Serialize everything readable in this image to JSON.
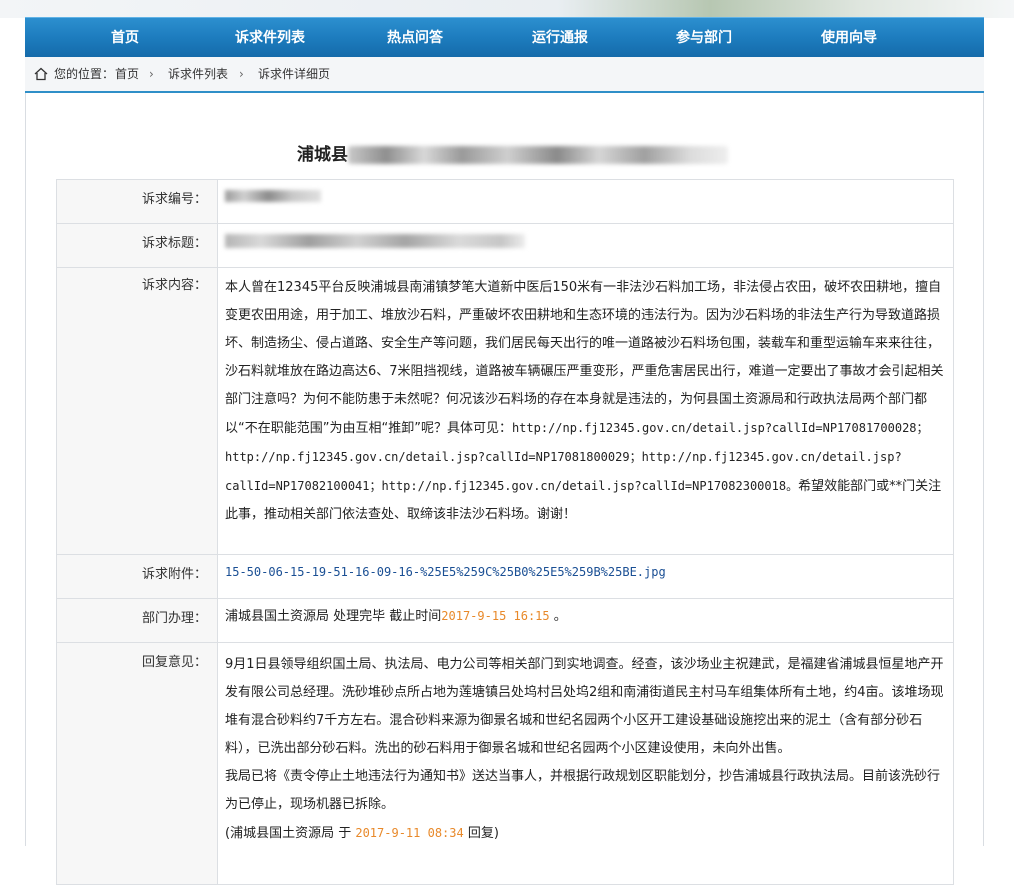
{
  "nav": {
    "items": [
      "首页",
      "诉求件列表",
      "热点问答",
      "运行通报",
      "参与部门",
      "使用向导"
    ]
  },
  "breadcrumb": {
    "prefix": "您的位置：",
    "items": [
      "首页",
      "诉求件列表",
      "诉求件详细页"
    ]
  },
  "page": {
    "title_prefix": "浦城县"
  },
  "detail": {
    "labels": {
      "number": "诉求编号：",
      "subject": "诉求标题：",
      "content": "诉求内容：",
      "attachment": "诉求附件：",
      "department": "部门办理：",
      "reply": "回复意见："
    },
    "content": {
      "part1": "本人曾在12345平台反映浦城县南浦镇梦笔大道新中医后150米有一非法沙石料加工场，非法侵占农田，破坏农田耕地，擅自变更农田用途，用于加工、堆放沙石料，严重破坏农田耕地和生态环境的违法行为。因为沙石料场的非法生产行为导致道路损坏、制造扬尘、侵占道路、安全生产等问题，我们居民每天出行的唯一道路被沙石料场包围，装载车和重型运输车来来往往，沙石料就堆放在路边高达6、7米阻挡视线，道路被车辆碾压严重变形，严重危害居民出行，难道一定要出了事故才会引起相关部门注意吗？为何不能防患于未然呢？何况该沙石料场的存在本身就是违法的，为何县国土资源局和行政执法局两个部门都以“不在职能范围”为由互相“推卸”呢？具体可见：",
      "links": "http://np.fj12345.gov.cn/detail.jsp?callId=NP17081700028；http://np.fj12345.gov.cn/detail.jsp?callId=NP17081800029；http://np.fj12345.gov.cn/detail.jsp?callId=NP17082100041；http://np.fj12345.gov.cn/detail.jsp?callId=NP17082300018。",
      "part2": "希望效能部门或**门关注此事，推动相关部门依法查处、取缔该非法沙石料场。谢谢！"
    },
    "attachment": "15-50-06-15-19-51-16-09-16-%25E5%259C%25B0%25E5%259B%25BE.jpg",
    "department": {
      "text": "浦城县国土资源局 处理完毕 截止时间",
      "deadline": "2017-9-15 16:15",
      "suffix": "。"
    },
    "reply": {
      "p1": "9月1日县领导组织国土局、执法局、电力公司等相关部门到实地调查。经查，该沙场业主祝建武，是福建省浦城县恒星地产开发有限公司总经理。洗砂堆砂点所占地为莲塘镇吕处坞村吕处坞2组和南浦街道民主村马车组集体所有土地，约4亩。该堆场现堆有混合砂料约7千方左右。混合砂料来源为御景名城和世纪名园两个小区开工建设基础设施挖出来的泥土（含有部分砂石料），已洗出部分砂石料。洗出的砂石料用于御景名城和世纪名园两个小区建设使用，未向外出售。",
      "p2": "我局已将《责令停止土地违法行为通知书》送达当事人，并根据行政规划区职能划分，抄告浦城县行政执法局。目前该洗砂行为已停止，现场机器已拆除。",
      "sign_prefix": "(浦城县国土资源局 于",
      "sign_date": "2017-9-11 08:34",
      "sign_suffix": "回复)"
    }
  }
}
